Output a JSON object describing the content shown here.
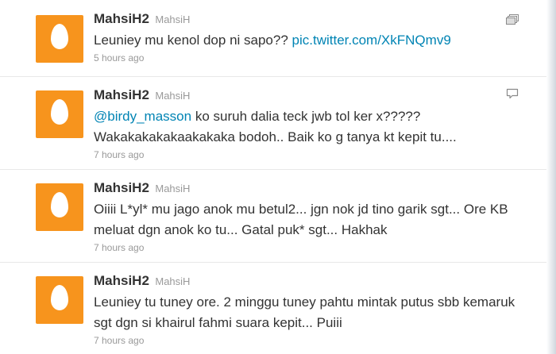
{
  "tweets": [
    {
      "fullname": "MahsiH2",
      "screenname": "MahsiH",
      "text_parts": {
        "before": "Leuniey mu kenol dop ni sapo?? ",
        "link": "pic.twitter.com/XkFNQmv9"
      },
      "timestamp": "5 hours ago",
      "icon": "media-gallery-icon"
    },
    {
      "fullname": "MahsiH2",
      "screenname": "MahsiH",
      "text_parts": {
        "mention": "@birdy_masson",
        "after": " ko suruh dalia teck jwb tol ker x????? Wakakakakakaakakaka bodoh.. Baik ko g tanya kt kepit tu...."
      },
      "timestamp": "7 hours ago",
      "icon": "conversation-icon"
    },
    {
      "fullname": "MahsiH2",
      "screenname": "MahsiH",
      "text": "Oiiii L*yl* mu jago anok mu betul2... jgn nok jd tino garik sgt... Ore KB meluat dgn anok ko tu... Gatal puk* sgt... Hakhak",
      "timestamp": "7 hours ago"
    },
    {
      "fullname": "MahsiH2",
      "screenname": "MahsiH",
      "text": "Leuniey tu tuney ore. 2 minggu tuney pahtu mintak putus sbb kemaruk sgt dgn si khairul fahmi suara kepit... Puiii",
      "timestamp": "7 hours ago"
    }
  ],
  "colors": {
    "avatar_bg": "#f7941d",
    "link": "#0084b4",
    "name": "#333333",
    "meta": "#999999"
  }
}
